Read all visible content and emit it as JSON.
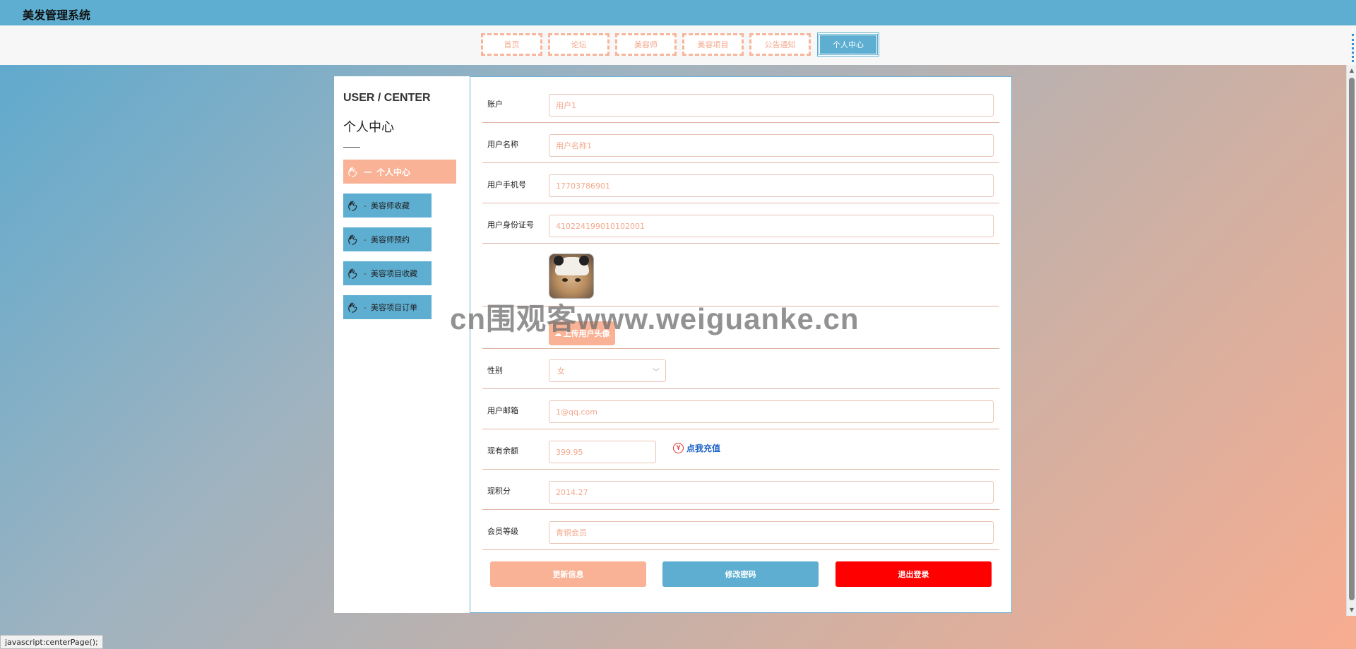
{
  "app": {
    "title": "美发管理系统"
  },
  "nav": {
    "tabs": [
      {
        "label": "首页"
      },
      {
        "label": "论坛"
      },
      {
        "label": "美容师"
      },
      {
        "label": "美容项目"
      },
      {
        "label": "公告通知"
      },
      {
        "label": "个人中心",
        "active": true
      }
    ]
  },
  "sidebar": {
    "title_en": "USER / CENTER",
    "title_cn": "个人中心",
    "items": [
      {
        "label": "个人中心",
        "icon": "hand-icon",
        "active": true
      },
      {
        "label": "美容师收藏",
        "icon": "hand-icon"
      },
      {
        "label": "美容师预约",
        "icon": "hand-icon"
      },
      {
        "label": "美容项目收藏",
        "icon": "hand-icon"
      },
      {
        "label": "美容项目订单",
        "icon": "hand-icon"
      }
    ]
  },
  "form": {
    "account": {
      "label": "账户",
      "value": "用户1"
    },
    "username": {
      "label": "用户名称",
      "value": "用户名称1"
    },
    "phone": {
      "label": "用户手机号",
      "value": "17703786901"
    },
    "idcard": {
      "label": "用户身份证号",
      "value": "410224199010102001"
    },
    "upload_label": "上传用户头像",
    "gender": {
      "label": "性别",
      "value": "女"
    },
    "email": {
      "label": "用户邮箱",
      "value": "1@qq.com"
    },
    "balance": {
      "label": "现有余额",
      "value": "399.95",
      "recharge_label": "点我充值",
      "recharge_symbol": "¥"
    },
    "points": {
      "label": "现积分",
      "value": "2014.27"
    },
    "level": {
      "label": "会员等级",
      "value": "青铜会员"
    }
  },
  "buttons": {
    "update": "更新信息",
    "change_password": "修改密码",
    "logout": "退出登录"
  },
  "watermark": "cn围观客www.weiguanke.cn",
  "statusbar": {
    "text": "javascript:centerPage();"
  },
  "colors": {
    "topbar": "#5daed1",
    "accent_peach": "#f9b295",
    "accent_blue": "#5daed1",
    "danger": "#ff0000",
    "link": "#1e63c8"
  }
}
